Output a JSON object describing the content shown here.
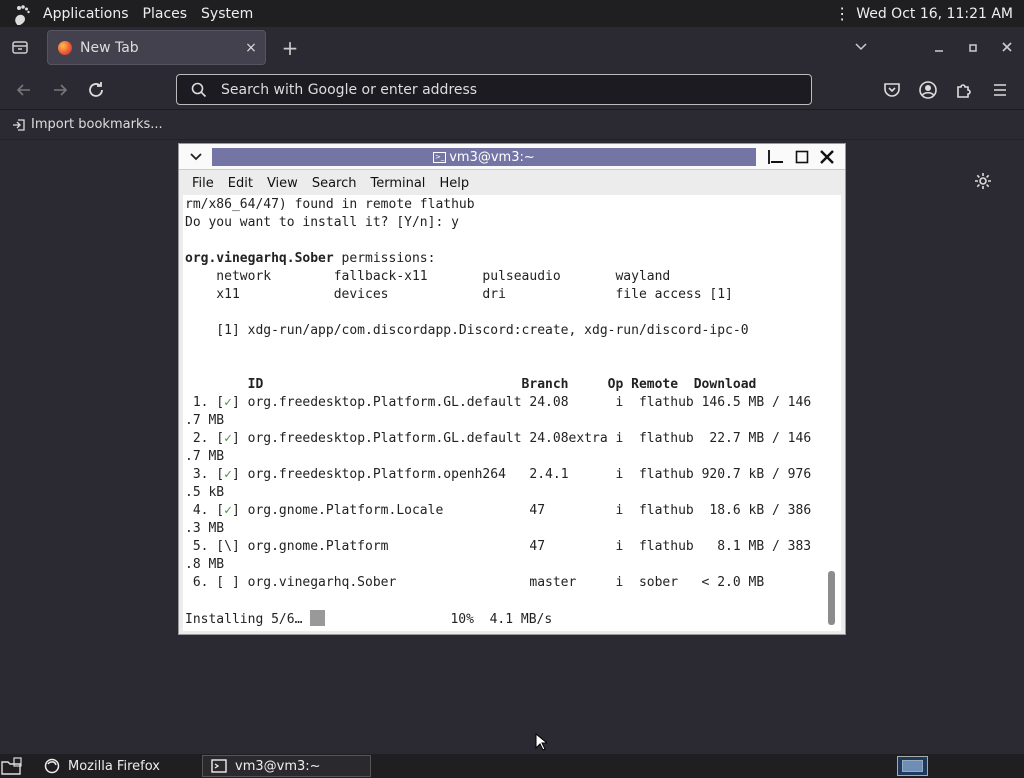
{
  "topbar": {
    "menus": [
      "Applications",
      "Places",
      "System"
    ],
    "clock": "Wed Oct 16, 11:21 AM"
  },
  "browser": {
    "tab_label": "New Tab",
    "tab_close": "×",
    "new_tab": "+",
    "url_placeholder": "Search with Google or enter address",
    "import_bookmarks": "Import bookmarks..."
  },
  "terminal": {
    "title": "vm3@vm3:~",
    "menus": [
      "File",
      "Edit",
      "View",
      "Search",
      "Terminal",
      "Help"
    ],
    "lines": [
      "rm/x86_64/47) found in remote flathub",
      "Do you want to install it? [Y/n]: y",
      "",
      "org.vinegarhq.Sober permissions:",
      "    network        fallback-x11       pulseaudio       wayland",
      "    x11            devices            dri              file access [1]",
      "",
      "    [1] xdg-run/app/com.discordapp.Discord:create, xdg-run/discord-ipc-0",
      "",
      "",
      "        ID                                 Branch     Op Remote  Download",
      " 1. [✓] org.freedesktop.Platform.GL.default 24.08      i  flathub 146.5 MB / 146",
      ".7 MB",
      " 2. [✓] org.freedesktop.Platform.GL.default 24.08extra i  flathub  22.7 MB / 146",
      ".7 MB",
      " 3. [✓] org.freedesktop.Platform.openh264   2.4.1      i  flathub 920.7 kB / 976",
      ".5 kB",
      " 4. [✓] org.gnome.Platform.Locale           47         i  flathub  18.6 kB / 386",
      ".3 MB",
      " 5. [\\] org.gnome.Platform                  47         i  flathub   8.1 MB / 383",
      ".8 MB",
      " 6. [ ] org.vinegarhq.Sober                 master     i  sober   < 2.0 MB",
      ""
    ],
    "status_left": "Installing 5/6…",
    "status_right": "10%  4.1 MB/s"
  },
  "taskbar": {
    "firefox_label": "Mozilla Firefox",
    "terminal_label": "vm3@vm3:~"
  }
}
